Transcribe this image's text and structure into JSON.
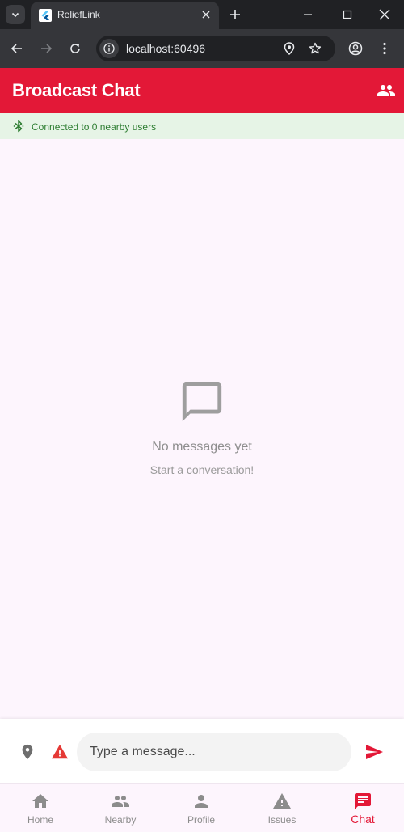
{
  "browser": {
    "tab_title": "ReliefLink",
    "url": "localhost:60496"
  },
  "appbar": {
    "title": "Broadcast Chat",
    "action_icon": "people-icon"
  },
  "connection": {
    "icon": "bluetooth-icon",
    "text": "Connected to 0 nearby users"
  },
  "empty_state": {
    "icon": "chat-bubble-outline-icon",
    "title": "No messages yet",
    "subtitle": "Start a conversation!"
  },
  "composer": {
    "placeholder": "Type a message...",
    "value": ""
  },
  "bottom_nav": {
    "items": [
      {
        "label": "Home",
        "icon": "home-icon",
        "active": false
      },
      {
        "label": "Nearby",
        "icon": "people-icon",
        "active": false
      },
      {
        "label": "Profile",
        "icon": "person-icon",
        "active": false
      },
      {
        "label": "Issues",
        "icon": "warning-icon",
        "active": false
      },
      {
        "label": "Chat",
        "icon": "chat-icon",
        "active": true
      }
    ]
  },
  "colors": {
    "brand": "#e31837",
    "connected": "#2e7d32",
    "connected_bg": "#e6f4e6",
    "page_bg": "#fdf5fd"
  }
}
